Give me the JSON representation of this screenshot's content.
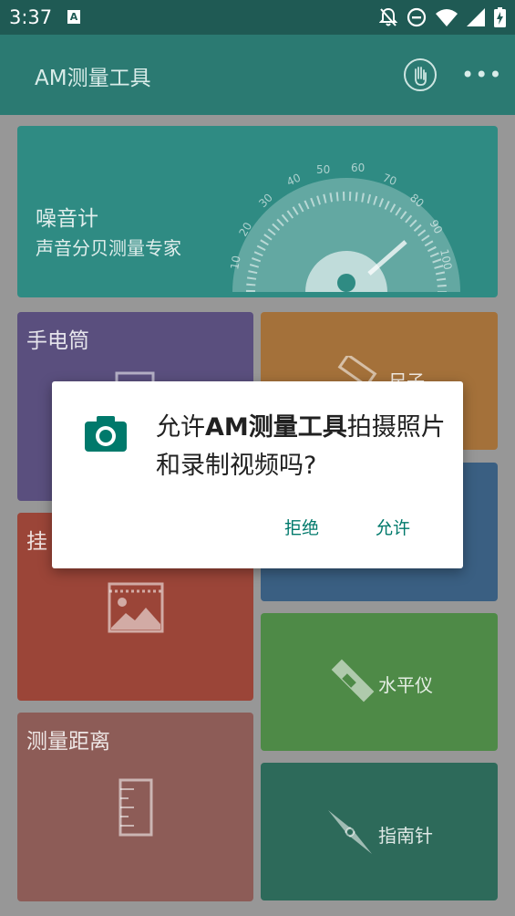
{
  "status_bar": {
    "time": "3:37",
    "keyboard_badge": "A"
  },
  "app_bar": {
    "title": "AM测量工具"
  },
  "cards": {
    "noise": {
      "title": "噪音计",
      "subtitle": "声音分贝测量专家",
      "dial_ticks": [
        "10",
        "20",
        "30",
        "40",
        "50",
        "60",
        "70",
        "80",
        "90",
        "100"
      ]
    },
    "flashlight": {
      "title": "手电筒"
    },
    "ruler": {
      "title": "尺子"
    },
    "hang_picture": {
      "title": "挂"
    },
    "level": {
      "title": "水平仪"
    },
    "distance": {
      "title": "测量距离"
    },
    "compass": {
      "title": "指南针"
    }
  },
  "dialog": {
    "msg_pre": "允许",
    "msg_app": "AM测量工具",
    "msg_post": "拍摄照片和录制视频吗?",
    "deny": "拒绝",
    "allow": "允许"
  },
  "colors": {
    "teal_dark": "#1f5a54",
    "teal": "#2b7a72",
    "noise_card": "#2f8b83",
    "flashlight_card": "#5a4f7e",
    "ruler_card": "#a4713a",
    "blue_card": "#3a5f82",
    "picture_card": "#9b4538",
    "level_card": "#4e8a47",
    "distance_card": "#8d5c57",
    "compass_card": "#2d6a5a",
    "accent": "#00796b"
  }
}
